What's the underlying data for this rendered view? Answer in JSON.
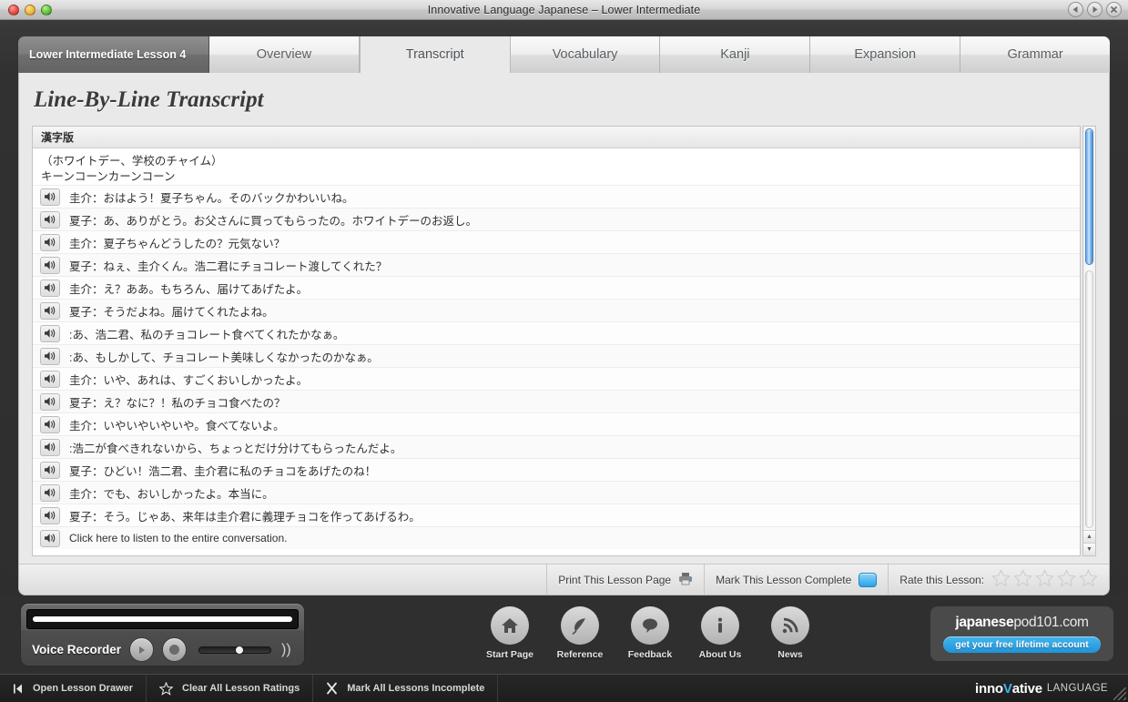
{
  "window": {
    "title": "Innovative Language Japanese – Lower Intermediate",
    "controls": {
      "back": "back-button",
      "forward": "forward-button",
      "close": "close-button"
    }
  },
  "tabs": [
    {
      "label": "Lower Intermediate Lesson 4",
      "kind": "lesson",
      "active": false
    },
    {
      "label": "Overview",
      "kind": "page",
      "active": false
    },
    {
      "label": "Transcript",
      "kind": "page",
      "active": true
    },
    {
      "label": "Vocabulary",
      "kind": "page",
      "active": false
    },
    {
      "label": "Kanji",
      "kind": "page",
      "active": false
    },
    {
      "label": "Expansion",
      "kind": "page",
      "active": false
    },
    {
      "label": "Grammar",
      "kind": "page",
      "active": false
    }
  ],
  "page": {
    "title": "Line-By-Line Transcript",
    "panel_header": "漢字版",
    "intro_lines": [
      "（ホワイトデー、学校のチャイム）",
      "キーンコーンカーンコーン"
    ],
    "lines": [
      "圭介：おはよう！夏子ちゃん。そのバックかわいいね。",
      "夏子：あ、ありがとう。お父さんに買ってもらったの。ホワイトデーのお返し。",
      "圭介：夏子ちゃんどうしたの？元気ない？",
      "夏子：ねぇ、圭介くん。浩二君にチョコレート渡してくれた？",
      "圭介：え？ああ。もちろん、届けてあげたよ。",
      "夏子：そうだよね。届けてくれたよね。",
      ":あ、浩二君、私のチョコレート食べてくれたかなぁ。",
      ":あ、もしかして、チョコレート美味しくなかったのかなぁ。",
      "圭介：いや、あれは、すごくおいしかったよ。",
      "夏子：え？なに？！私のチョコ食べたの？",
      "圭介：いやいやいやいや。食べてないよ。",
      ":浩二が食べきれないから、ちょっとだけ分けてもらったんだよ。",
      "夏子：ひどい！浩二君、圭介君に私のチョコをあげたのね！",
      "圭介：でも、おいしかったよ。本当に。",
      "夏子：そう。じゃあ、来年は圭介君に義理チョコを作ってあげるわ。",
      "Click here to listen to the entire conversation."
    ],
    "footer": {
      "print_label": "Print This Lesson Page",
      "complete_label": "Mark This Lesson Complete",
      "rate_label": "Rate this Lesson:",
      "star_count": 5,
      "stars_filled": 0
    }
  },
  "recorder": {
    "label": "Voice Recorder",
    "play_icon": "play-icon",
    "record_icon": "record-icon",
    "volume_icon": "volume-icon",
    "volume_value": 55
  },
  "dock_nav": [
    {
      "label": "Start Page",
      "icon": "home-icon"
    },
    {
      "label": "Reference",
      "icon": "feather-icon"
    },
    {
      "label": "Feedback",
      "icon": "speech-bubble-icon"
    },
    {
      "label": "About Us",
      "icon": "info-icon"
    },
    {
      "label": "News",
      "icon": "rss-icon"
    }
  ],
  "promo": {
    "title_bold": "japanese",
    "title_light": "pod101.com",
    "button_label": "get your free lifetime account"
  },
  "statusbar": {
    "items": [
      {
        "label": "Open Lesson Drawer",
        "icon": "drawer-icon"
      },
      {
        "label": "Clear All Lesson Ratings",
        "icon": "star-outline-icon"
      },
      {
        "label": "Mark All Lessons Incomplete",
        "icon": "x-mark-icon"
      }
    ],
    "brand_pre": "inno",
    "brand_v": "V",
    "brand_post": "ative",
    "brand_suffix": "LANGUAGE"
  },
  "colors": {
    "accent_blue": "#2aa3e8",
    "scrollbar_blue": "#6ea9e6",
    "dark_chrome": "#2f2f2f",
    "panel_bg": "#ffffff"
  }
}
